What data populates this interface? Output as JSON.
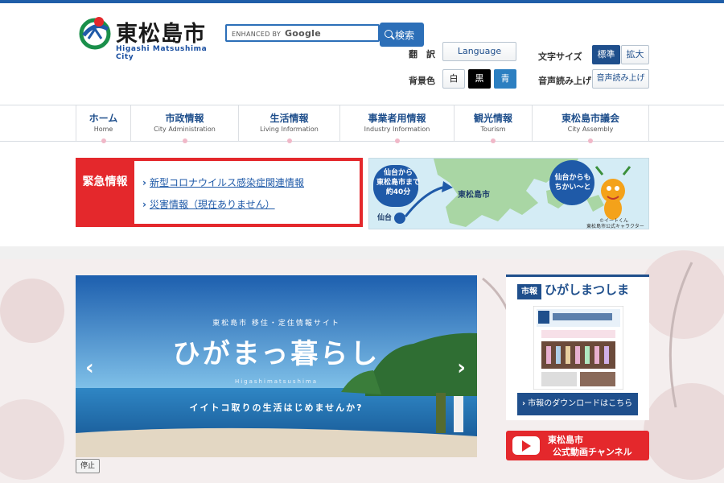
{
  "site": {
    "name": "東松島市",
    "name_en": "Higashi Matsushima City"
  },
  "search": {
    "placeholder_prefix": "ENHANCED BY",
    "placeholder_brand": "Google",
    "button_label": "検索"
  },
  "utility": {
    "translate_label": "翻　訳",
    "language_button": "Language",
    "font_size_label": "文字サイズ",
    "font_standard": "標準",
    "font_large": "拡大",
    "bg_color_label": "背景色",
    "bg_white": "白",
    "bg_black": "黒",
    "bg_blue": "青",
    "read_aloud_label": "音声読み上げ",
    "read_aloud_button": "音声読み上げ"
  },
  "nav": {
    "items": [
      {
        "ja": "ホーム",
        "en": "Home"
      },
      {
        "ja": "市政情報",
        "en": "City Administration"
      },
      {
        "ja": "生活情報",
        "en": "Living Information"
      },
      {
        "ja": "事業者用情報",
        "en": "Industry Information"
      },
      {
        "ja": "観光情報",
        "en": "Tourism"
      },
      {
        "ja": "東松島市議会",
        "en": "City Assembly"
      }
    ]
  },
  "emergency": {
    "title": "緊急情報",
    "links": [
      "新型コロナウイルス感染症関連情報",
      "災害情報（現在ありません）"
    ]
  },
  "map_banner": {
    "callout": [
      "仙台から",
      "東松島市まで",
      "約40分"
    ],
    "sendai": "仙台",
    "city": "東松島市",
    "bubble": [
      "仙台からも",
      "ちかい〜と"
    ],
    "mascot_name": "©イートくん",
    "mascot_caption": "東松島市公式キャラクター"
  },
  "slider": {
    "kicker": "東松島市 移住・定住情報サイト",
    "title": "ひがまっ暮らし",
    "title_en": "Higashimatsushima",
    "tagline": "イイトコ取りの生活はじめませんか?",
    "prev_icon": "‹",
    "next_icon": "›",
    "stop_label": "停止"
  },
  "kohou": {
    "badge": "市報",
    "title": "ひがしまつしま",
    "download_link": "市報のダウンロードはこちら"
  },
  "youtube": {
    "line1": "東松島市",
    "line2": "公式動画チャンネル"
  },
  "colors": {
    "brand_blue": "#1f4f8c",
    "emergency_red": "#e4282c",
    "youtube_red": "#e4282c"
  }
}
